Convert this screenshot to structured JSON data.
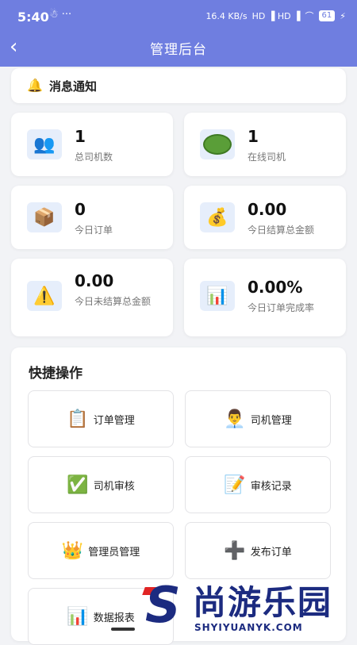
{
  "status_bar": {
    "time": "5:40",
    "left_icons": "☃ ···",
    "speed": "16.4 KB/s",
    "network": "HD ▐ HD ▐",
    "battery": "61"
  },
  "nav": {
    "title": "管理后台",
    "back_icon": "back-arrow-icon"
  },
  "notice": {
    "label": "消息通知",
    "icon": "bell-icon"
  },
  "stats": [
    {
      "icon": "users-icon",
      "glyph": "👥",
      "value": "1",
      "label": "总司机数"
    },
    {
      "icon": "online-icon",
      "glyph": "",
      "value": "1",
      "label": "在线司机"
    },
    {
      "icon": "box-icon",
      "glyph": "📦",
      "value": "0",
      "label": "今日订单"
    },
    {
      "icon": "money-bag-icon",
      "glyph": "💰",
      "value": "0.00",
      "label": "今日结算总金额"
    },
    {
      "icon": "warning-icon",
      "glyph": "⚠️",
      "value": "0.00",
      "label": "今日未结算总金额"
    },
    {
      "icon": "chart-icon",
      "glyph": "📊",
      "value": "0.00%",
      "label": "今日订单完成率"
    }
  ],
  "quick_actions": {
    "heading": "快捷操作",
    "items": [
      {
        "icon": "clipboard-icon",
        "glyph": "📋",
        "label": "订单管理"
      },
      {
        "icon": "driver-icon",
        "glyph": "👨‍💼",
        "label": "司机管理"
      },
      {
        "icon": "check-icon",
        "glyph": "✅",
        "label": "司机审核"
      },
      {
        "icon": "memo-icon",
        "glyph": "📝",
        "label": "审核记录"
      },
      {
        "icon": "crown-icon",
        "glyph": "👑",
        "label": "管理员管理"
      },
      {
        "icon": "plus-icon",
        "glyph": "➕",
        "label": "发布订单"
      },
      {
        "icon": "report-icon",
        "glyph": "📊",
        "label": "数据报表"
      }
    ]
  },
  "watermark": {
    "logo": "S",
    "name": "尚游乐园",
    "url": "SHYIYUANYK.COM"
  }
}
